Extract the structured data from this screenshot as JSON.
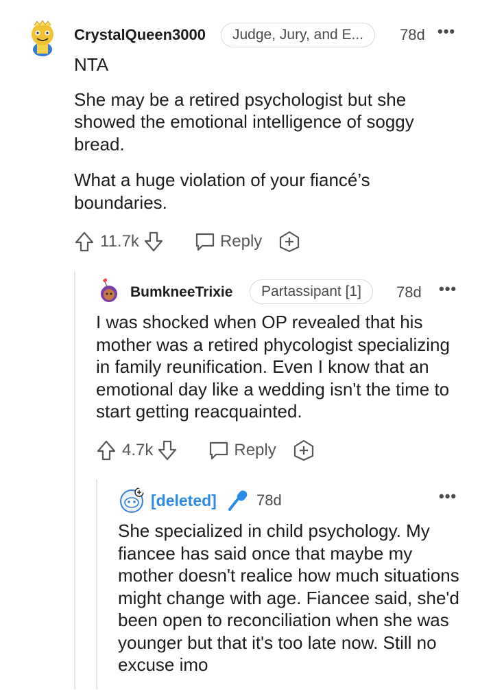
{
  "comments": [
    {
      "username": "CrystalQueen3000",
      "flair": "Judge, Jury, and E...",
      "age": "78d",
      "paragraphs": [
        "NTA",
        "She may be a retired psychologist but she showed the emotional intelligence of soggy bread.",
        "What a huge violation of your fiancé’s boundaries."
      ],
      "score": "11.7k",
      "reply_label": "Reply"
    },
    {
      "username": "BumkneeTrixie",
      "flair": "Partassipant [1]",
      "age": "78d",
      "paragraphs": [
        "I was shocked when OP revealed that his mother was a retired phycologist specializing in family reunification. Even I know that an emotional day like a wedding isn't the time to start getting reacquainted."
      ],
      "score": "4.7k",
      "reply_label": "Reply"
    },
    {
      "username": "[deleted]",
      "age": "78d",
      "paragraphs": [
        "She specialized in child psychology. My fiancee has said once that maybe my mother doesn't realice how much situations might change with age. Fiancee said, she'd been open to reconciliation when she was younger but that it's too late now. Still no excuse imo"
      ]
    }
  ],
  "icons": {
    "upvote": "arrow-up-icon",
    "downvote": "arrow-down-icon",
    "reply": "speech-bubble-icon",
    "award": "award-plus-icon",
    "more": "more-dots-icon",
    "mic": "microphone-icon"
  },
  "colors": {
    "deleted_user": "#2b8ae5",
    "text": "#1c1c1c",
    "meta": "#4a4a4a"
  }
}
